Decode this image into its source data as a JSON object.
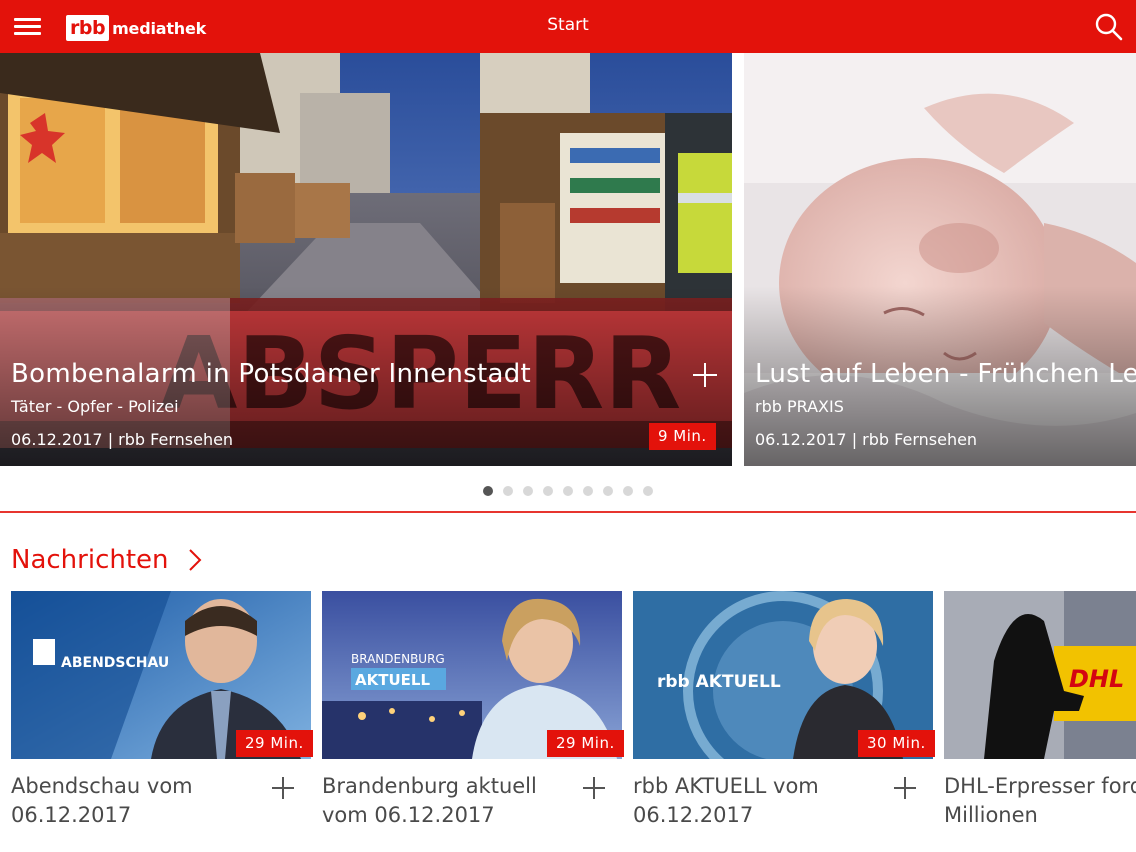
{
  "header": {
    "title": "Start",
    "logo_mark": "rbb",
    "logo_text": "mediathek",
    "brand_color": "#e3120b"
  },
  "hero": {
    "slides": [
      {
        "title": "Bombenalarm in Potsdamer Innenstadt",
        "subtitle": "Täter - Opfer - Polizei",
        "meta": "06.12.2017 | rbb Fernsehen",
        "duration": "9 Min."
      },
      {
        "title": "Lust auf Leben - Frühchen Levi",
        "subtitle": "rbb PRAXIS",
        "meta": "06.12.2017 | rbb Fernsehen"
      }
    ],
    "page_count": 9,
    "active_index": 0
  },
  "section": {
    "title": "Nachrichten",
    "tiles": [
      {
        "title": "Abendschau vom 06.12.2017",
        "duration": "29 Min.",
        "thumb_text": "ABENDSCHAU"
      },
      {
        "title": "Brandenburg aktuell vom 06.12.2017",
        "duration": "29 Min.",
        "thumb_text_1": "BRANDENBURG",
        "thumb_text_2": "AKTUELL"
      },
      {
        "title": "rbb AKTUELL vom 06.12.2017",
        "duration": "30 Min.",
        "thumb_text": "rbb AKTUELL"
      },
      {
        "title": "DHL-Erpresser fordert Millionen",
        "thumb_text": "DHL"
      }
    ]
  }
}
